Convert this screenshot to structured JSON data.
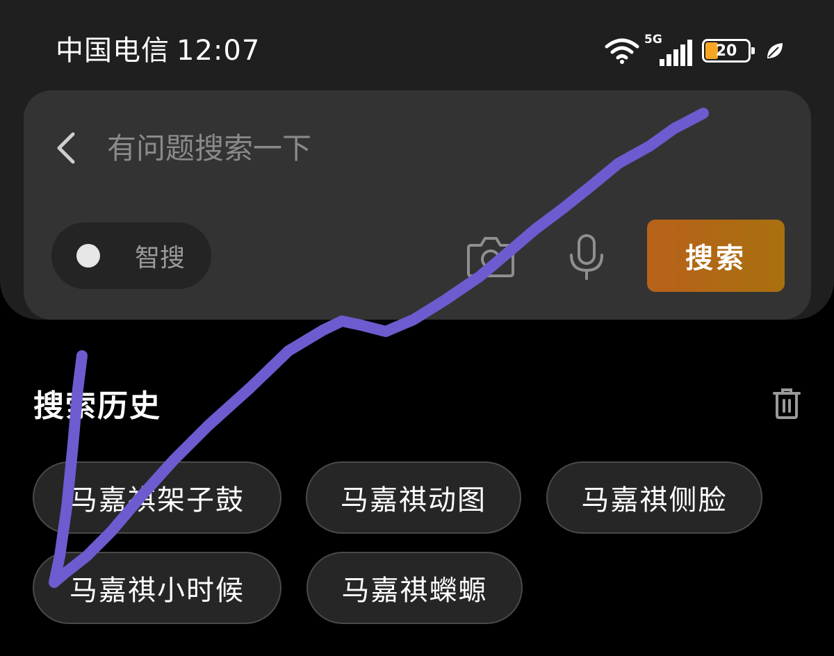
{
  "status_bar": {
    "carrier": "中国电信",
    "time": "12:07",
    "network": "5G",
    "battery_level": "20",
    "battery_color": "#f5a623"
  },
  "search": {
    "back_icon": "chevron-left-icon",
    "placeholder": "有问题搜索一下",
    "smart_search_label": "智搜",
    "camera_icon": "camera-icon",
    "mic_icon": "microphone-icon",
    "button_label": "搜索",
    "button_color": "#b8611a"
  },
  "history": {
    "title": "搜索历史",
    "clear_icon": "trash-icon",
    "items": [
      "马嘉祺架子鼓",
      "马嘉祺动图",
      "马嘉祺侧脸",
      "马嘉祺小时候",
      "马嘉祺蠑螈"
    ]
  },
  "annotation": {
    "stroke_color": "#6c5ccf"
  }
}
